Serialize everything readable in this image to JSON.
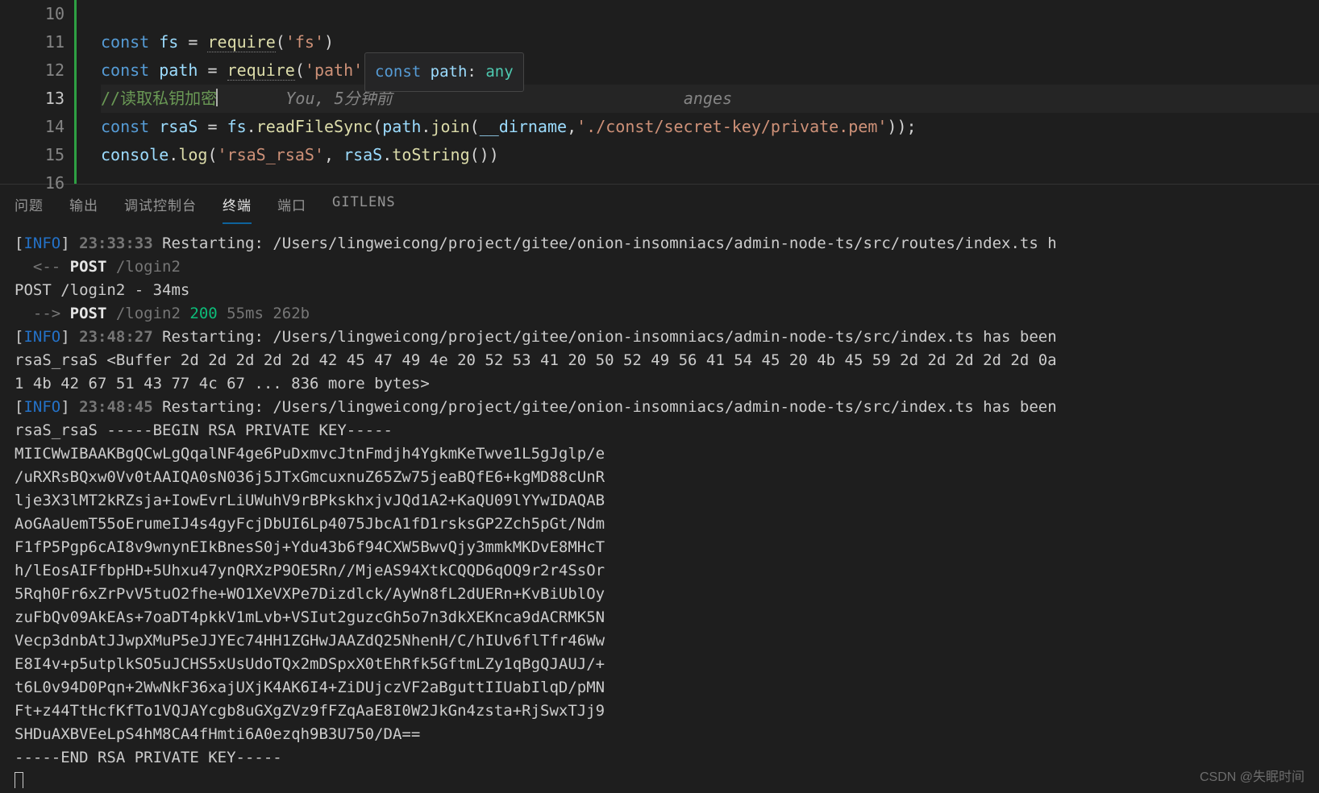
{
  "editor": {
    "lineNumbers": [
      "10",
      "11",
      "12",
      "13",
      "14",
      "15",
      "16"
    ],
    "activeLine": "13",
    "code": {
      "l11_const": "const",
      "l11_fs": "fs",
      "l11_eq": " = ",
      "l11_req": "require",
      "l11_p1": "(",
      "l11_s": "'fs'",
      "l11_p2": ")",
      "l12_const": "const",
      "l12_path": "path",
      "l12_eq": " = ",
      "l12_req": "require",
      "l12_p1": "(",
      "l12_s": "'path'",
      "l12_p2": ")",
      "l13_cmt": "//读取私钥加密",
      "l13_blame": "You, 5分钟前",
      "l13_blame_tail": "anges",
      "l14_const": "const",
      "l14_rsaS": "rsaS",
      "l14_eq": " = ",
      "l14_fs": "fs",
      "l14_dot1": ".",
      "l14_rfs": "readFileSync",
      "l14_p1": "(",
      "l14_path": "path",
      "l14_dot2": ".",
      "l14_join": "join",
      "l14_p2": "(",
      "l14_dir": "__dirname",
      "l14_comma": ",",
      "l14_s": "'./const/secret-key/private.pem'",
      "l14_p3": "));",
      "l15_console": "console",
      "l15_dot": ".",
      "l15_log": "log",
      "l15_p1": "(",
      "l15_s": "'rsaS_rsaS'",
      "l15_comma": ", ",
      "l15_rsaS": "rsaS",
      "l15_dot2": ".",
      "l15_ts": "toString",
      "l15_p2": "())"
    },
    "tooltip": {
      "kw": "const",
      "var": "path",
      "colon": ": ",
      "type": "any"
    }
  },
  "panel": {
    "tabs": {
      "problems": "问题",
      "output": "输出",
      "debug": "调试控制台",
      "terminal": "终端",
      "ports": "端口",
      "gitlens": "GITLENS"
    }
  },
  "terminal": {
    "info": "INFO",
    "line1_time": "23:33:33",
    "line1_rest": " Restarting: /Users/lingweicong/project/gitee/onion-insomniacs/admin-node-ts/src/routes/index.ts h",
    "line2_arrow": "  <-- ",
    "line2_post": "POST",
    "line2_path": " /login2",
    "line3": "POST /login2 - 34ms",
    "line4_arrow": "  --> ",
    "line4_post": "POST",
    "line4_path": " /login2 ",
    "line4_200": "200",
    "line4_tail": " 55ms 262b",
    "line5_time": "23:48:27",
    "line5_rest": " Restarting: /Users/lingweicong/project/gitee/onion-insomniacs/admin-node-ts/src/index.ts has been",
    "line6": "rsaS_rsaS <Buffer 2d 2d 2d 2d 2d 42 45 47 49 4e 20 52 53 41 20 50 52 49 56 41 54 45 20 4b 45 59 2d 2d 2d 2d 2d 0a",
    "line7": "1 4b 42 67 51 43 77 4c 67 ... 836 more bytes>",
    "line8_time": "23:48:45",
    "line8_rest": " Restarting: /Users/lingweicong/project/gitee/onion-insomniacs/admin-node-ts/src/index.ts has been",
    "key_block": "rsaS_rsaS -----BEGIN RSA PRIVATE KEY-----\nMIICWwIBAAKBgQCwLgQqalNF4ge6PuDxmvcJtnFmdjh4YgkmKeTwve1L5gJglp/e\n/uRXRsBQxw0Vv0tAAIQA0sN036j5JTxGmcuxnuZ65Zw75jeaBQfE6+kgMD88cUnR\nlje3X3lMT2kRZsja+IowEvrLiUWuhV9rBPkskhxjvJQd1A2+KaQU09lYYwIDAQAB\nAoGAaUemT55oErumeIJ4s4gyFcjDbUI6Lp4075JbcA1fD1rsksGP2Zch5pGt/Ndm\nF1fP5Pgp6cAI8v9wnynEIkBnesS0j+Ydu43b6f94CXW5BwvQjy3mmkMKDvE8MHcT\nh/lEosAIFfbpHD+5Uhxu47ynQRXzP9OE5Rn//MjeAS94XtkCQQD6qOQ9r2r4SsOr\n5Rqh0Fr6xZrPvV5tuO2fhe+WO1XeVXPe7Dizdlck/AyWn8fL2dUERn+KvBiUblOy\nzuFbQv09AkEAs+7oaDT4pkkV1mLvb+VSIut2guzcGh5o7n3dkXEKnca9dACRMK5N\nVecp3dnbAtJJwpXMuP5eJJYEc74HH1ZGHwJAAZdQ25NhenH/C/hIUv6flTfr46Ww\nE8I4v+p5utplkSO5uJCHS5xUsUdoTQx2mDSpxX0tEhRfk5GftmLZy1qBgQJAUJ/+\nt6L0v94D0Pqn+2WwNkF36xajUXjK4AK6I4+ZiDUjczVF2aBguttIIUabIlqD/pMN\nFt+z44TtHcfKfTo1VQJAYcgb8uGXgZVz9fFZqAaE8I0W2JkGn4zsta+RjSwxTJj9\nSHDuAXBVEeLpS4hM8CA4fHmti6A0ezqh9B3U750/DA==\n-----END RSA PRIVATE KEY-----"
  },
  "watermark": "CSDN @失眠时间"
}
